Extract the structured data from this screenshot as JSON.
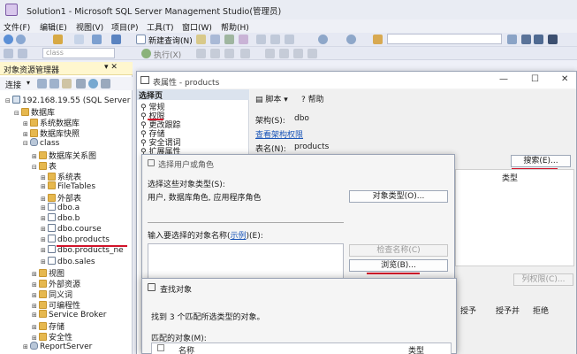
{
  "window": {
    "title": "Solution1 - Microsoft SQL Server Management Studio(管理员)"
  },
  "menu": [
    "文件(F)",
    "编辑(E)",
    "视图(V)",
    "项目(P)",
    "工具(T)",
    "窗口(W)",
    "帮助(H)"
  ],
  "toolbar": {
    "new_query": "新建查询(N)",
    "execute": "执行(X)",
    "db_combo": "class"
  },
  "object_explorer": {
    "title": "对象资源管理器",
    "connect": "连接",
    "tree": [
      {
        "label": "192.168.19.55 (SQL Server",
        "indent": 0,
        "exp": "⊟",
        "icon": "server"
      },
      {
        "label": "数据库",
        "indent": 1,
        "exp": "⊟",
        "icon": "folder"
      },
      {
        "label": "系统数据库",
        "indent": 2,
        "exp": "⊞",
        "icon": "folder"
      },
      {
        "label": "数据库快照",
        "indent": 2,
        "exp": "⊞",
        "icon": "folder"
      },
      {
        "label": "class",
        "indent": 2,
        "exp": "⊟",
        "icon": "db"
      },
      {
        "label": "数据库关系图",
        "indent": 3,
        "exp": "⊞",
        "icon": "folder"
      },
      {
        "label": "表",
        "indent": 3,
        "exp": "⊟",
        "icon": "folder"
      },
      {
        "label": "系统表",
        "indent": 4,
        "exp": "⊞",
        "icon": "folder"
      },
      {
        "label": "FileTables",
        "indent": 4,
        "exp": "⊞",
        "icon": "folder"
      },
      {
        "label": "外部表",
        "indent": 4,
        "exp": "⊞",
        "icon": "folder"
      },
      {
        "label": "dbo.a",
        "indent": 4,
        "exp": "⊞",
        "icon": "tbl"
      },
      {
        "label": "dbo.b",
        "indent": 4,
        "exp": "⊞",
        "icon": "tbl"
      },
      {
        "label": "dbo.course",
        "indent": 4,
        "exp": "⊞",
        "icon": "tbl"
      },
      {
        "label": "dbo.products",
        "indent": 4,
        "exp": "⊞",
        "icon": "tbl"
      },
      {
        "label": "dbo.products_ne",
        "indent": 4,
        "exp": "⊞",
        "icon": "tbl"
      },
      {
        "label": "dbo.sales",
        "indent": 4,
        "exp": "⊞",
        "icon": "tbl"
      },
      {
        "label": "视图",
        "indent": 3,
        "exp": "⊞",
        "icon": "folder"
      },
      {
        "label": "外部资源",
        "indent": 3,
        "exp": "⊞",
        "icon": "folder"
      },
      {
        "label": "同义词",
        "indent": 3,
        "exp": "⊞",
        "icon": "folder"
      },
      {
        "label": "可编程性",
        "indent": 3,
        "exp": "⊞",
        "icon": "folder"
      },
      {
        "label": "Service Broker",
        "indent": 3,
        "exp": "⊞",
        "icon": "folder"
      },
      {
        "label": "存储",
        "indent": 3,
        "exp": "⊞",
        "icon": "folder"
      },
      {
        "label": "安全性",
        "indent": 3,
        "exp": "⊞",
        "icon": "folder"
      },
      {
        "label": "ReportServer",
        "indent": 2,
        "exp": "⊞",
        "icon": "db"
      }
    ]
  },
  "table_props": {
    "title": "表属性 - products",
    "select_page": "选择页",
    "pages": [
      "常规",
      "权限",
      "更改跟踪",
      "存储",
      "安全谓词",
      "扩展属性"
    ],
    "script": "脚本",
    "help": "帮助",
    "schema_label": "架构(S):",
    "schema_value": "dbo",
    "view_schema_perms": "查看架构权限",
    "table_name_label": "表名(N):",
    "table_name_value": "products",
    "search_button": "搜索(E)...",
    "type_col": "类型",
    "column_perms_button": "列权限(C)...",
    "perm_cols": [
      "授予",
      "授予并",
      "拒绝"
    ]
  },
  "select_user": {
    "title": "选择用户或角色",
    "object_types_label": "选择这些对象类型(S):",
    "object_types_value": "用户, 数据库角色, 应用程序角色",
    "object_types_button": "对象类型(O)...",
    "names_label_pre": "输入要选择的对象名称(",
    "names_label_link": "示例",
    "names_label_post": ")(E):",
    "check_names_button": "检查名称(C)",
    "browse_button": "浏览(B)..."
  },
  "find_objects": {
    "title": "查找对象",
    "found_text": "找到 3 个匹配所选类型的对象。",
    "matched_label": "匹配的对象(M):",
    "col_name": "名称",
    "col_type": "类型"
  }
}
